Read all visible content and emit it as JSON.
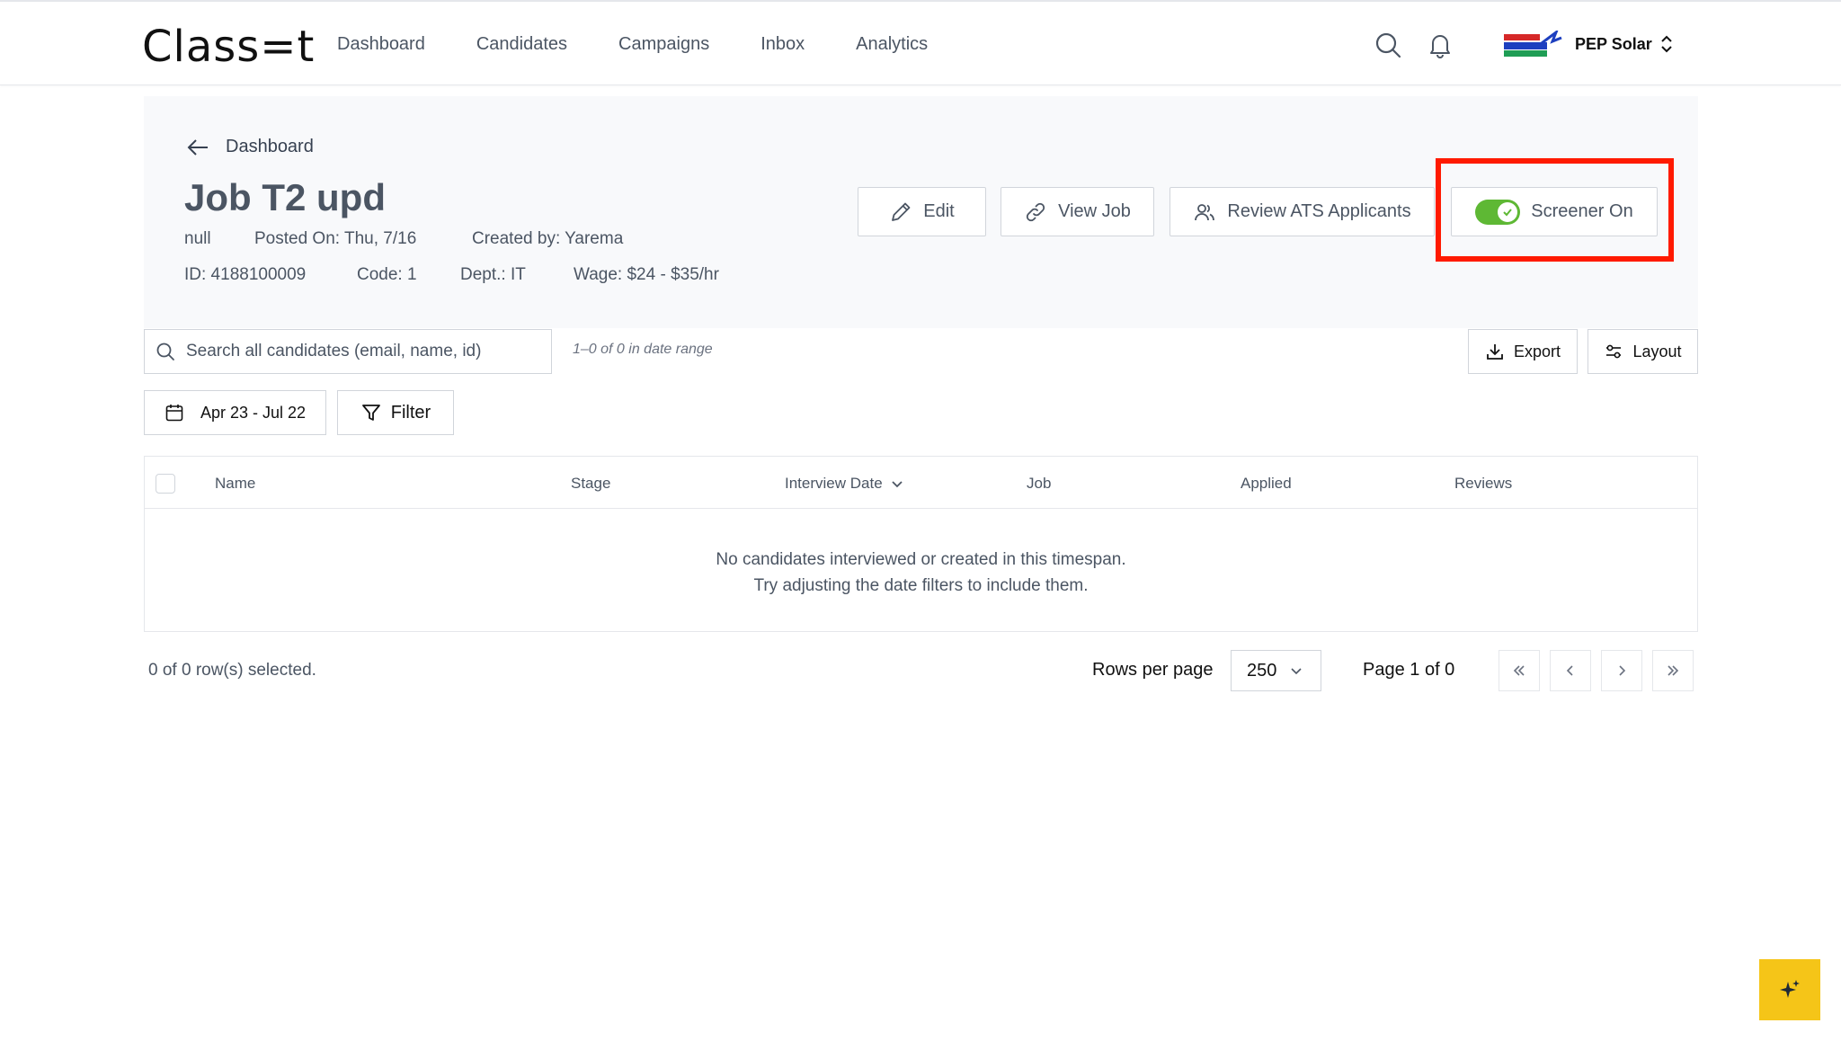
{
  "app": {
    "logo_text": "Class=t"
  },
  "nav": {
    "items": [
      {
        "label": "Dashboard"
      },
      {
        "label": "Candidates"
      },
      {
        "label": "Campaigns"
      },
      {
        "label": "Inbox"
      },
      {
        "label": "Analytics"
      }
    ]
  },
  "account": {
    "name": "PEP Solar"
  },
  "breadcrumb": {
    "back_label": "Dashboard"
  },
  "job": {
    "title": "Job T2 upd",
    "location": "null",
    "posted_on": "Posted On: Thu, 7/16",
    "created_by": "Created by: Yarema",
    "id": "ID: 4188100009",
    "code": "Code: 1",
    "dept": "Dept.: IT",
    "wage": "Wage: $24 - $35/hr"
  },
  "actions": {
    "edit_label": "Edit",
    "view_job_label": "View Job",
    "review_ats_label": "Review ATS Applicants",
    "screener_label": "Screener On",
    "screener_on": true
  },
  "search": {
    "placeholder": "Search all candidates (email, name, id)"
  },
  "range_text": "1–0 of 0 in date range",
  "toolbar": {
    "export_label": "Export",
    "layout_label": "Layout"
  },
  "date_range": {
    "label": "Apr 23 - Jul 22"
  },
  "filter": {
    "label": "Filter"
  },
  "table": {
    "columns": [
      "Name",
      "Stage",
      "Interview Date",
      "Job",
      "Applied",
      "Reviews"
    ],
    "empty_line1": "No candidates interviewed or created in this timespan.",
    "empty_line2": "Try adjusting the date filters to include them."
  },
  "footer": {
    "selected_text": "0 of 0 row(s) selected.",
    "rows_per_page_label": "Rows per page",
    "rows_per_page_value": "250",
    "page_text": "Page 1 of 0"
  },
  "colors": {
    "highlight": "#ff1a00",
    "toggle_on": "#5eb834",
    "fab": "#f5c518"
  }
}
